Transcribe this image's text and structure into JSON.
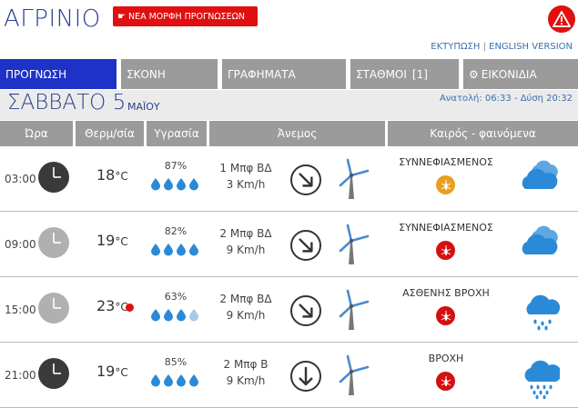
{
  "header": {
    "city": "ΑΓΡΙΝΙΟ",
    "new_form_button": "ΝΕΑ ΜΟΡΦΗ ΠΡΟΓΝΩΣΕΩΝ",
    "print_link": "ΕΚΤΥΠΩΣΗ",
    "separator": " | ",
    "english_link": "ENGLISH VERSION"
  },
  "nav": {
    "tabs": [
      {
        "label": "ΠΡΟΓΝΩΣΗ",
        "active": true
      },
      {
        "label": "ΣΚΟΝΗ",
        "active": false
      },
      {
        "label": "ΓΡΑΦΗΜΑΤΑ",
        "active": false
      },
      {
        "label": "ΣΤΑΘΜΟΙ",
        "count": "[1]",
        "active": false
      },
      {
        "label": "ΕΙΚΟΝΙΔΙΑ",
        "active": false
      }
    ]
  },
  "day": {
    "name": "ΣΑΒΒΑΤΟ 5",
    "month": "ΜΑΪΟΥ",
    "sun": "Ανατολή: 06:33 - Δύση 20:32"
  },
  "table": {
    "headers": [
      "Ώρα",
      "Θερμ/σία",
      "Υγρασία",
      "Άνεμος",
      "Καιρός - φαινόμενα"
    ],
    "rows": [
      {
        "time": "03:00",
        "clock": "dark",
        "temp": "18",
        "unit": "°C",
        "temp_alert": false,
        "humidity": "87%",
        "drops_full": 4,
        "drops_total": 4,
        "wind_force": "1 Μπφ ΒΔ",
        "wind_speed": "3 Km/h",
        "wind_dir": "NW",
        "condition": "ΣΥΝΝΕΦΙΑΣΜΕΝΟΣ",
        "badge_color": "#e8a020",
        "weather_icon": "cloudy-icon"
      },
      {
        "time": "09:00",
        "clock": "light",
        "temp": "19",
        "unit": "°C",
        "temp_alert": false,
        "humidity": "82%",
        "drops_full": 4,
        "drops_total": 4,
        "wind_force": "2 Μπφ ΒΔ",
        "wind_speed": "9 Km/h",
        "wind_dir": "NW",
        "condition": "ΣΥΝΝΕΦΙΑΣΜΕΝΟΣ",
        "badge_color": "#d41010",
        "weather_icon": "cloudy-icon"
      },
      {
        "time": "15:00",
        "clock": "light",
        "temp": "23",
        "unit": "°C",
        "temp_alert": true,
        "humidity": "63%",
        "drops_full": 3,
        "drops_total": 4,
        "wind_force": "2 Μπφ ΒΔ",
        "wind_speed": "9 Km/h",
        "wind_dir": "NW",
        "condition": "ΑΣΘΕΝΗΣ ΒΡΟΧΗ",
        "badge_color": "#d41010",
        "weather_icon": "light-rain-icon"
      },
      {
        "time": "21:00",
        "clock": "dark",
        "temp": "19",
        "unit": "°C",
        "temp_alert": false,
        "humidity": "85%",
        "drops_full": 4,
        "drops_total": 4,
        "wind_force": "2 Μπφ Β",
        "wind_speed": "9 Km/h",
        "wind_dir": "N",
        "condition": "ΒΡΟΧΗ",
        "badge_color": "#d41010",
        "weather_icon": "rain-icon"
      }
    ]
  },
  "colors": {
    "brand_blue": "#2b3f8f",
    "active_tab": "#1e32c8",
    "alert_red": "#e01010",
    "header_gray": "#9b9b9b",
    "drop_blue": "#2a8ad8",
    "cloud_blue": "#2a8ad8"
  }
}
